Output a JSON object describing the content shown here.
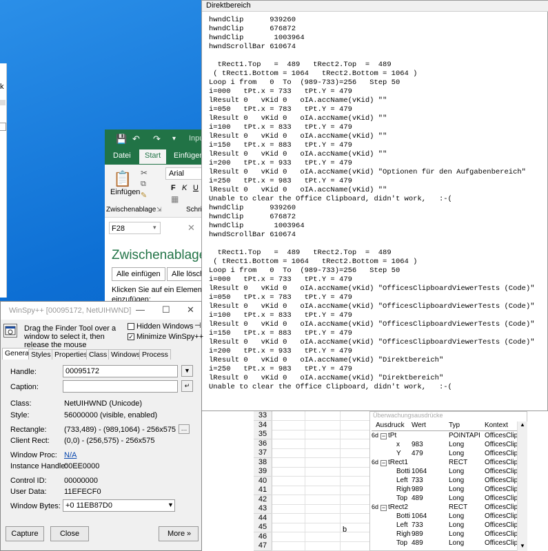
{
  "colors": {
    "desktop": "#0d6fd4",
    "excel_green": "#217346",
    "link": "#0645ad"
  },
  "excel": {
    "tabs": [
      "Datei",
      "Start",
      "Einfügen"
    ],
    "title_partial": "Inpu",
    "ribbon": {
      "paste_label": "Einfügen",
      "clipboard_group": "Zwischenablage",
      "font_name": "Arial",
      "font_group_partial": "Schrif",
      "bold": "F",
      "italic": "K",
      "underline": "U"
    },
    "namebox": "F28",
    "taskpane": {
      "title": "Zwischenablage",
      "paste_all": "Alle einfügen",
      "clear_all": "Alle lösche",
      "hint": "Klicken Sie auf ein Element, um",
      "hint2": "einzufügen:"
    },
    "rows": [
      "33",
      "34",
      "35",
      "36",
      "37",
      "38",
      "39",
      "40",
      "41",
      "42",
      "43",
      "44",
      "45",
      "46",
      "47"
    ],
    "cell_b": "b",
    "watch": {
      "title": "Überwachungsausdrücke",
      "headers": [
        "Ausdruck",
        "Wert",
        "Typ",
        "Kontext"
      ],
      "rows": [
        {
          "exp": "tPt",
          "val": "",
          "typ": "POINTAPI",
          "ctx": "OfficesClipbc",
          "indent": 0
        },
        {
          "exp": "x",
          "val": "983",
          "typ": "Long",
          "ctx": "OfficesClipbc",
          "indent": 1
        },
        {
          "exp": "Y",
          "val": "479",
          "typ": "Long",
          "ctx": "OfficesClipbc",
          "indent": 1
        },
        {
          "exp": "tRect1",
          "val": "",
          "typ": "RECT",
          "ctx": "OfficesClipbc",
          "indent": 0
        },
        {
          "exp": "Botti",
          "val": "1064",
          "typ": "Long",
          "ctx": "OfficesClipbc",
          "indent": 1
        },
        {
          "exp": "Left",
          "val": "733",
          "typ": "Long",
          "ctx": "OfficesClipbc",
          "indent": 1
        },
        {
          "exp": "Righ",
          "val": "989",
          "typ": "Long",
          "ctx": "OfficesClipbc",
          "indent": 1
        },
        {
          "exp": "Top",
          "val": "489",
          "typ": "Long",
          "ctx": "OfficesClipbc",
          "indent": 1
        },
        {
          "exp": "tRect2",
          "val": "",
          "typ": "RECT",
          "ctx": "OfficesClipbc",
          "indent": 0
        },
        {
          "exp": "Botti",
          "val": "1064",
          "typ": "Long",
          "ctx": "OfficesClipbc",
          "indent": 1
        },
        {
          "exp": "Left",
          "val": "733",
          "typ": "Long",
          "ctx": "OfficesClipbc",
          "indent": 1
        },
        {
          "exp": "Righ",
          "val": "989",
          "typ": "Long",
          "ctx": "OfficesClipbc",
          "indent": 1
        },
        {
          "exp": "Top",
          "val": "489",
          "typ": "Long",
          "ctx": "OfficesClipbc",
          "indent": 1
        }
      ]
    }
  },
  "direkt": {
    "title": "Direktbereich",
    "lines": [
      "hwndClip      939260",
      "hwndClip      676872",
      "hwndClip       1003964",
      "hwndScrollBar 610674",
      "",
      "  tRect1.Top   =  489   tRect2.Top  =  489",
      " ( tRect1.Bottom = 1064   tRect2.Bottom = 1064 )",
      "Loop i from   0  To  (989-733)=256   Step 50",
      "i=000   tPt.x = 733   tPt.Y = 479",
      "lResult 0   vKid 0   oIA.accName(vKid) \"\"",
      "i=050   tPt.x = 783   tPt.Y = 479",
      "lResult 0   vKid 0   oIA.accName(vKid) \"\"",
      "i=100   tPt.x = 833   tPt.Y = 479",
      "lResult 0   vKid 0   oIA.accName(vKid) \"\"",
      "i=150   tPt.x = 883   tPt.Y = 479",
      "lResult 0   vKid 0   oIA.accName(vKid) \"\"",
      "i=200   tPt.x = 933   tPt.Y = 479",
      "lResult 0   vKid 0   oIA.accName(vKid) \"Optionen für den Aufgabenbereich\"",
      "i=250   tPt.x = 983   tPt.Y = 479",
      "lResult 0   vKid 0   oIA.accName(vKid) \"\"",
      "Unable to clear the Office Clipboard, didn't work,   :-(",
      "hwndClip      939260",
      "hwndClip      676872",
      "hwndClip       1003964",
      "hwndScrollBar 610674",
      "",
      "  tRect1.Top   =  489   tRect2.Top  =  489",
      " ( tRect1.Bottom = 1064   tRect2.Bottom = 1064 )",
      "Loop i from   0  To  (989-733)=256   Step 50",
      "i=000   tPt.x = 733   tPt.Y = 479",
      "lResult 0   vKid 0   oIA.accName(vKid) \"OfficesClipboardViewerTests (Code)\"",
      "i=050   tPt.x = 783   tPt.Y = 479",
      "lResult 0   vKid 0   oIA.accName(vKid) \"OfficesClipboardViewerTests (Code)\"",
      "i=100   tPt.x = 833   tPt.Y = 479",
      "lResult 0   vKid 0   oIA.accName(vKid) \"OfficesClipboardViewerTests (Code)\"",
      "i=150   tPt.x = 883   tPt.Y = 479",
      "lResult 0   vKid 0   oIA.accName(vKid) \"OfficesClipboardViewerTests (Code)\"",
      "i=200   tPt.x = 933   tPt.Y = 479",
      "lResult 0   vKid 0   oIA.accName(vKid) \"Direktbereich\"",
      "i=250   tPt.x = 983   tPt.Y = 479",
      "lResult 0   vKid 0   oIA.accName(vKid) \"Direktbereich\"",
      "Unable to clear the Office Clipboard, didn't work,   :-("
    ]
  },
  "winspy": {
    "title": "WinSpy++ [00095172, NetUIHWND]",
    "drag_text": "Drag the Finder Tool over a window to select it, then release the mouse",
    "hidden_windows": "Hidden Windows",
    "minimize": "Minimize WinSpy++",
    "tabs": [
      "General",
      "Styles",
      "Properties",
      "Class",
      "Windows",
      "Process"
    ],
    "fields": {
      "handle_label": "Handle:",
      "handle_value": "00095172",
      "caption_label": "Caption:",
      "caption_value": "",
      "class_label": "Class:",
      "class_value": "NetUIHWND  (Unicode)",
      "style_label": "Style:",
      "style_value": "56000000  (visible, enabled)",
      "rect_label": "Rectangle:",
      "rect_value": "(733,489) - (989,1064)  -  256x575",
      "client_label": "Client Rect:",
      "client_value": "(0,0) - (256,575)  -  256x575",
      "proc_label": "Window Proc:",
      "proc_value": "N/A",
      "inst_label": "Instance Handle:",
      "inst_value": "00EE0000",
      "ctrl_label": "Control ID:",
      "ctrl_value": "00000000",
      "user_label": "User Data:",
      "user_value": "11EFECF0",
      "bytes_label": "Window Bytes:",
      "bytes_value": "+0         11EB87D0"
    },
    "buttons": {
      "capture": "Capture",
      "close": "Close",
      "more": "More"
    }
  }
}
